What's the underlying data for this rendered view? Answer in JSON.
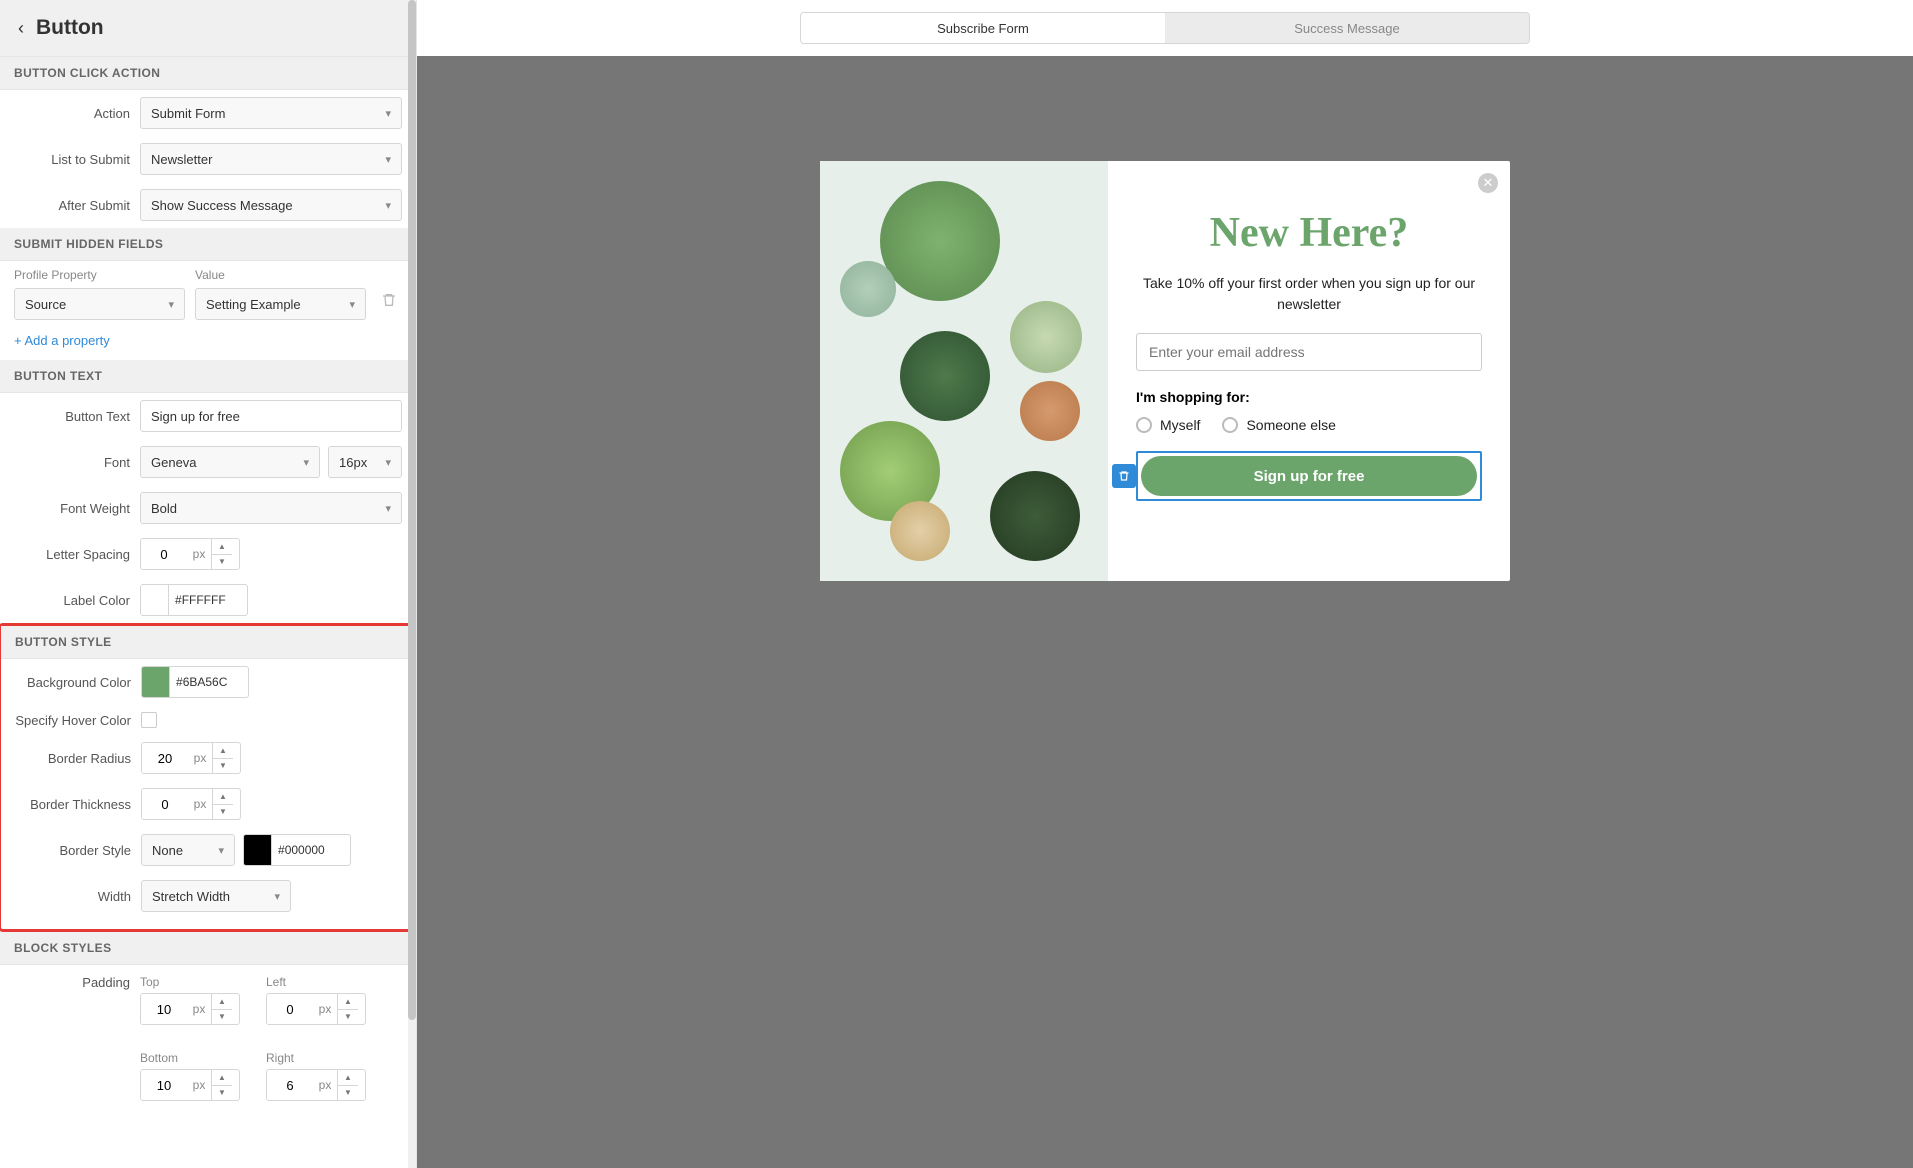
{
  "sidebar": {
    "title": "Button",
    "sections": {
      "click_action": {
        "header": "BUTTON CLICK ACTION",
        "action_label": "Action",
        "action_value": "Submit Form",
        "list_label": "List to Submit",
        "list_value": "Newsletter",
        "after_label": "After Submit",
        "after_value": "Show Success Message"
      },
      "hidden_fields": {
        "header": "SUBMIT HIDDEN FIELDS",
        "profile_label": "Profile Property",
        "value_label": "Value",
        "profile_value": "Source",
        "value_value": "Setting Example",
        "add_link": "+ Add a property"
      },
      "text": {
        "header": "BUTTON TEXT",
        "text_label": "Button Text",
        "text_value": "Sign up for free",
        "font_label": "Font",
        "font_value": "Geneva",
        "font_size": "16px",
        "weight_label": "Font Weight",
        "weight_value": "Bold",
        "spacing_label": "Letter Spacing",
        "spacing_value": "0",
        "spacing_unit": "px",
        "label_color_label": "Label Color",
        "label_color_value": "FFFFFF"
      },
      "style": {
        "header": "BUTTON STYLE",
        "bg_label": "Background Color",
        "bg_value": "6BA56C",
        "bg_swatch": "#6ba56c",
        "hover_label": "Specify Hover Color",
        "radius_label": "Border Radius",
        "radius_value": "20",
        "radius_unit": "px",
        "thickness_label": "Border Thickness",
        "thickness_value": "0",
        "thickness_unit": "px",
        "border_style_label": "Border Style",
        "border_style_value": "None",
        "border_color_swatch": "#000000",
        "border_color_value": "000000",
        "width_label": "Width",
        "width_value": "Stretch Width"
      },
      "block": {
        "header": "BLOCK STYLES",
        "padding_label": "Padding",
        "top_label": "Top",
        "top_value": "10",
        "left_label": "Left",
        "left_value": "0",
        "bottom_label": "Bottom",
        "bottom_value": "10",
        "right_label": "Right",
        "right_value": "6",
        "unit": "px"
      }
    }
  },
  "tabs": {
    "subscribe": "Subscribe Form",
    "success": "Success Message"
  },
  "popup": {
    "heading": "New Here?",
    "subtext": "Take 10% off your first order when you sign up for our newsletter",
    "email_placeholder": "Enter your email address",
    "shopping_label": "I'm shopping for:",
    "opt1": "Myself",
    "opt2": "Someone else",
    "button": "Sign up for free"
  },
  "colors": {
    "accent": "#6ba56c",
    "editor_blue": "#2f8bd8",
    "canvas_bg": "#767676"
  }
}
